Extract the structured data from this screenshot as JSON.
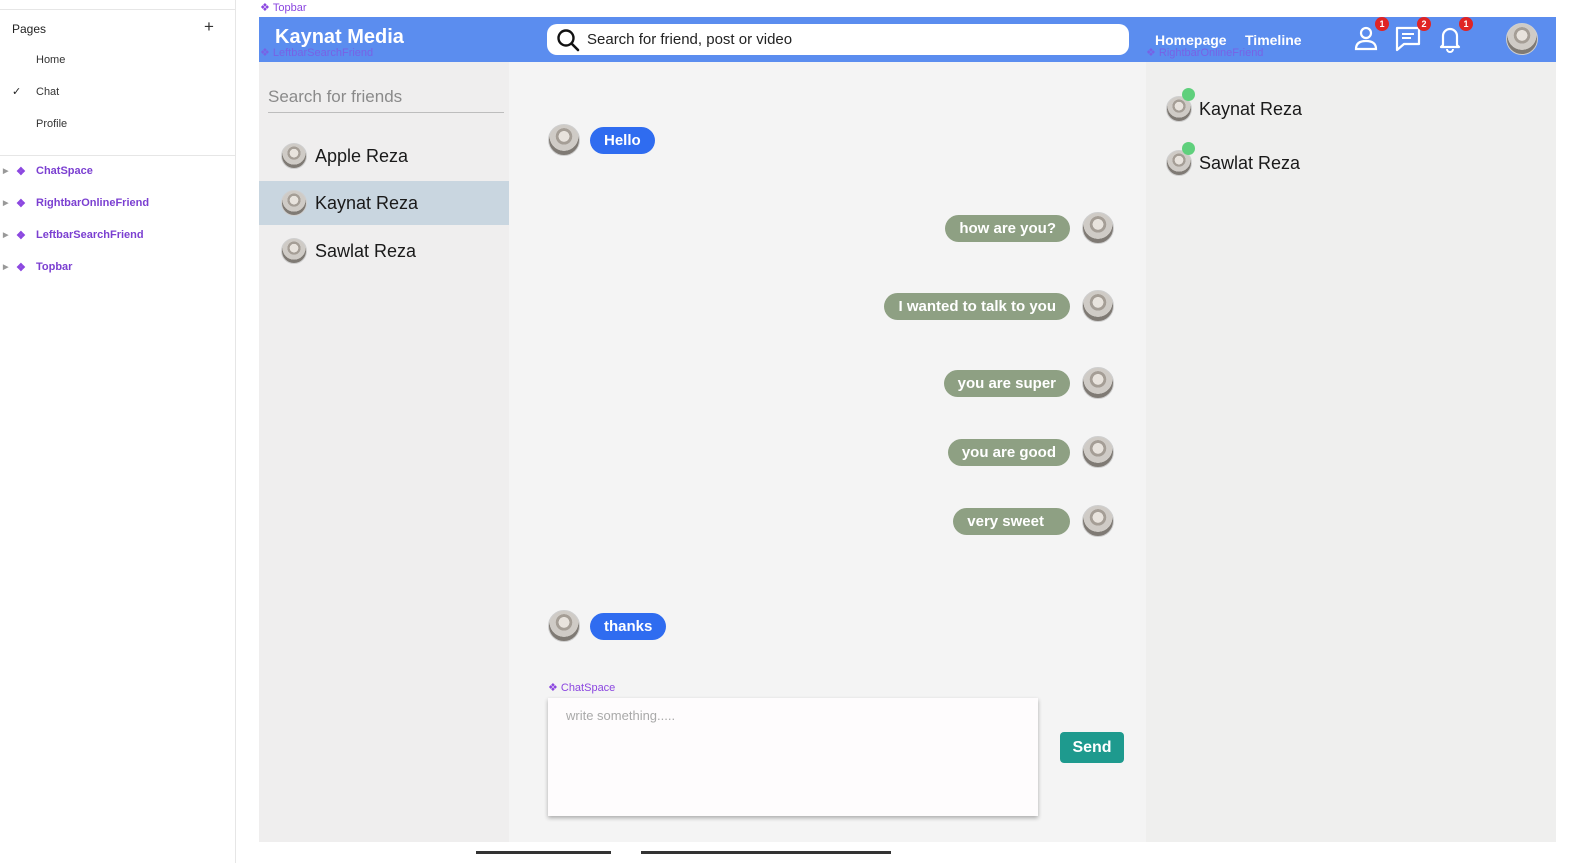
{
  "layers_panel": {
    "pages_title": "Pages",
    "add_icon": "plus-icon",
    "pages": [
      {
        "label": "Home",
        "checked": false
      },
      {
        "label": "Chat",
        "checked": true
      },
      {
        "label": "Profile",
        "checked": false
      }
    ],
    "components": [
      "ChatSpace",
      "RightbarOnlineFriend",
      "LeftbarSearchFriend",
      "Topbar"
    ]
  },
  "frame_labels": {
    "topbar": "Topbar",
    "leftbar": "LeftbarSearchFriend",
    "rightbar": "RightbarOnlineFriend",
    "chatspace": "ChatSpace"
  },
  "topbar": {
    "logo": "Kaynat Media",
    "search_placeholder": "Search for friend, post or video",
    "nav": [
      "Homepage",
      "Timeline"
    ],
    "icons": [
      {
        "name": "person-icon",
        "badge": "1"
      },
      {
        "name": "chat-icon",
        "badge": "2"
      },
      {
        "name": "bell-icon",
        "badge": "1"
      }
    ],
    "accent_color": "#5b8def"
  },
  "leftbar": {
    "search_placeholder": "Search for friends",
    "friends": [
      {
        "name": "Apple Reza",
        "selected": false
      },
      {
        "name": "Kaynat Reza",
        "selected": true
      },
      {
        "name": "Sawlat Reza",
        "selected": false
      }
    ]
  },
  "chat": {
    "messages": [
      {
        "text": "Hello",
        "direction": "in"
      },
      {
        "text": "how are you?",
        "direction": "out"
      },
      {
        "text": "I wanted to talk to you",
        "direction": "out"
      },
      {
        "text": "you are super",
        "direction": "out"
      },
      {
        "text": "you are good",
        "direction": "out"
      },
      {
        "text": "very sweet",
        "direction": "out"
      },
      {
        "text": "thanks",
        "direction": "in"
      }
    ],
    "composer_placeholder": "write something.....",
    "send_label": "Send"
  },
  "rightbar": {
    "online_friends": [
      "Kaynat Reza",
      "Sawlat Reza"
    ]
  }
}
